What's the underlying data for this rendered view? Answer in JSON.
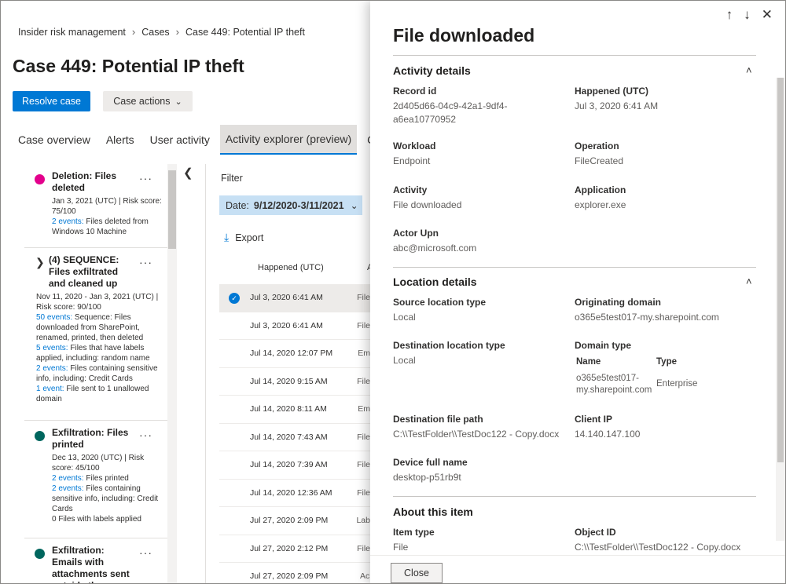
{
  "breadcrumb": [
    "Insider risk management",
    "Cases",
    "Case 449: Potential IP theft"
  ],
  "page_title": "Case 449: Potential IP theft",
  "actions": {
    "resolve": "Resolve case",
    "case_actions": "Case actions"
  },
  "tabs": [
    "Case overview",
    "Alerts",
    "User activity",
    "Activity explorer (preview)",
    "Co"
  ],
  "alerts": [
    {
      "title": "Deletion: Files deleted",
      "color": "#e3008c",
      "meta1": "Jan 3, 2021 (UTC) | Risk score: 75/100",
      "link1": "2 events:",
      "text1": " Files deleted from Windows 10 Machine"
    },
    {
      "title": "(4) SEQUENCE: Files exfiltrated and cleaned up",
      "meta1": "Nov 11, 2020 - Jan 3, 2021 (UTC) | Risk score: 90/100",
      "lines": [
        {
          "link": "50 events:",
          "text": " Sequence: Files downloaded from SharePoint, renamed, printed, then deleted"
        },
        {
          "link": "5 events:",
          "text": " Files that have labels applied, including: random name"
        },
        {
          "link": "2 events:",
          "text": " Files containing sensitive info, including: Credit Cards"
        },
        {
          "link": "1 event:",
          "text": " File sent to 1 unallowed domain"
        }
      ]
    },
    {
      "title": "Exfiltration: Files printed",
      "color": "#00665e",
      "meta1": "Dec 13, 2020 (UTC) | Risk score: 45/100",
      "lines": [
        {
          "link": "2 events:",
          "text": " Files printed"
        },
        {
          "link": "2 events:",
          "text": " Files containing sensitive info, including: Credit Cards"
        },
        {
          "link": "",
          "text": "0 Files with labels applied"
        }
      ]
    },
    {
      "title": "Exfiltration: Emails with attachments sent outside the",
      "color": "#00665e"
    }
  ],
  "filter": {
    "label": "Filter",
    "date_prefix": "Date:",
    "date_value": "9/12/2020-3/11/2021"
  },
  "export_label": "Export",
  "table": {
    "col_happened": "Happened (UTC)",
    "col_a": "A",
    "rows": [
      {
        "date": "Jul 3, 2020 6:41 AM",
        "op": "File"
      },
      {
        "date": "Jul 3, 2020 6:41 AM",
        "op": "File"
      },
      {
        "date": "Jul 14, 2020 12:07 PM",
        "op": "Em"
      },
      {
        "date": "Jul 14, 2020 9:15 AM",
        "op": "File"
      },
      {
        "date": "Jul 14, 2020 8:11 AM",
        "op": "Em"
      },
      {
        "date": "Jul 14, 2020 7:43 AM",
        "op": "File"
      },
      {
        "date": "Jul 14, 2020 7:39 AM",
        "op": "File"
      },
      {
        "date": "Jul 14, 2020 12:36 AM",
        "op": "File"
      },
      {
        "date": "Jul 27, 2020 2:09 PM",
        "op": "Lab"
      },
      {
        "date": "Jul 27, 2020 2:12 PM",
        "op": "File"
      },
      {
        "date": "Jul 27, 2020 2:09 PM",
        "op": "Ac"
      }
    ]
  },
  "panel": {
    "title": "File downloaded",
    "activity_details": {
      "heading": "Activity details",
      "record_id_label": "Record id",
      "record_id": "2d405d66-04c9-42a1-9df4-a6ea10770952",
      "happened_label": "Happened (UTC)",
      "happened": "Jul 3, 2020 6:41 AM",
      "workload_label": "Workload",
      "workload": "Endpoint",
      "operation_label": "Operation",
      "operation": "FileCreated",
      "activity_label": "Activity",
      "activity": "File downloaded",
      "application_label": "Application",
      "application": "explorer.exe",
      "actor_label": "Actor Upn",
      "actor": "abc@microsoft.com"
    },
    "location_details": {
      "heading": "Location details",
      "source_type_label": "Source location type",
      "source_type": "Local",
      "orig_domain_label": "Originating domain",
      "orig_domain": "o365e5test017-my.sharepoint.com",
      "dest_type_label": "Destination location type",
      "dest_type": "Local",
      "domain_type_label": "Domain type",
      "domain_table": {
        "name_h": "Name",
        "type_h": "Type",
        "name": "o365e5test017-my.sharepoint.com",
        "type": "Enterprise"
      },
      "dest_path_label": "Destination file path",
      "dest_path": "C:\\\\TestFolder\\\\TestDoc122 - Copy.docx",
      "client_ip_label": "Client IP",
      "client_ip": "14.140.147.100",
      "device_label": "Device full name",
      "device": "desktop-p51rb9t"
    },
    "about_item": {
      "heading": "About this item",
      "item_type_label": "Item type",
      "item_type": "File",
      "object_id_label": "Object ID",
      "object_id": "C:\\\\TestFolder\\\\TestDoc122 - Copy.docx"
    },
    "close_label": "Close"
  }
}
